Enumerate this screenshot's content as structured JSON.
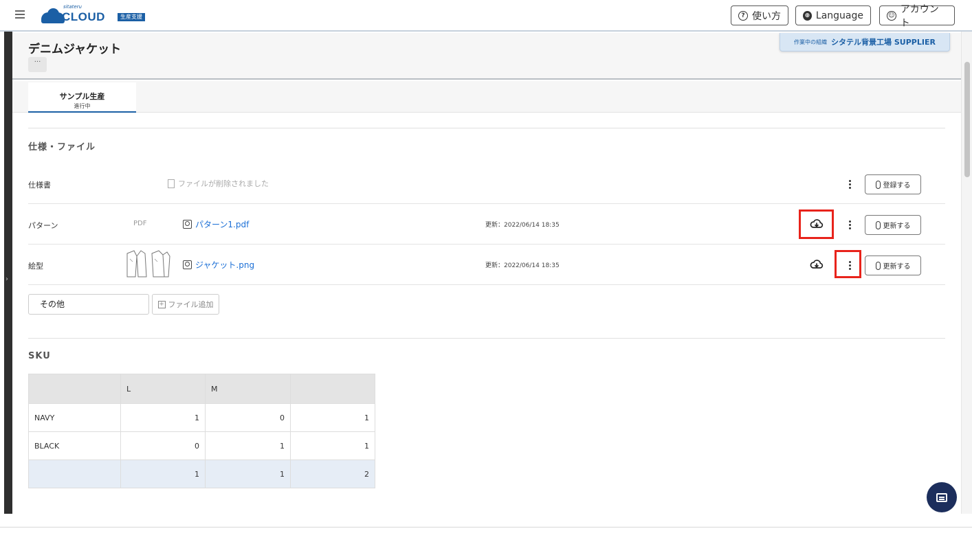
{
  "header": {
    "logo_small": "sitateru",
    "logo_text": "CLOUD",
    "logo_badge": "生産支援",
    "help_label": "使い方",
    "language_label": "Language",
    "account_label": "アカウント"
  },
  "org": {
    "label": "作業中の組織",
    "name": "シタテル背景工場 SUPPLIER"
  },
  "page": {
    "title": "デニムジャケット",
    "more": "···"
  },
  "tab": {
    "label": "サンプル生産",
    "status": "進行中"
  },
  "files_section": {
    "title": "仕様・ファイル",
    "rows": [
      {
        "label": "仕様書",
        "type": "",
        "file": "ファイルが削除されました",
        "updated": "",
        "button": "登録する"
      },
      {
        "label": "パターン",
        "type": "PDF",
        "file": "パターン1.pdf",
        "updated": "更新：2022/06/14 18:35",
        "button": "更新する"
      },
      {
        "label": "絵型",
        "type": "",
        "file": "ジャケット.png",
        "updated": "更新：2022/06/14 18:35",
        "button": "更新する"
      }
    ],
    "other_label": "その他",
    "add_file_label": "ファイル追加"
  },
  "sku": {
    "title": "SKU",
    "headers": [
      "",
      "L",
      "M",
      ""
    ],
    "rows": [
      {
        "name": "NAVY",
        "values": [
          "1",
          "0",
          "1"
        ]
      },
      {
        "name": "BLACK",
        "values": [
          "0",
          "1",
          "1"
        ]
      },
      {
        "name": "",
        "values": [
          "1",
          "1",
          "2"
        ]
      }
    ]
  },
  "colors": {
    "brand": "#1b5fa5",
    "link": "#1b6fd6",
    "highlight": "#e8231b",
    "chat": "#1c2e5c"
  }
}
